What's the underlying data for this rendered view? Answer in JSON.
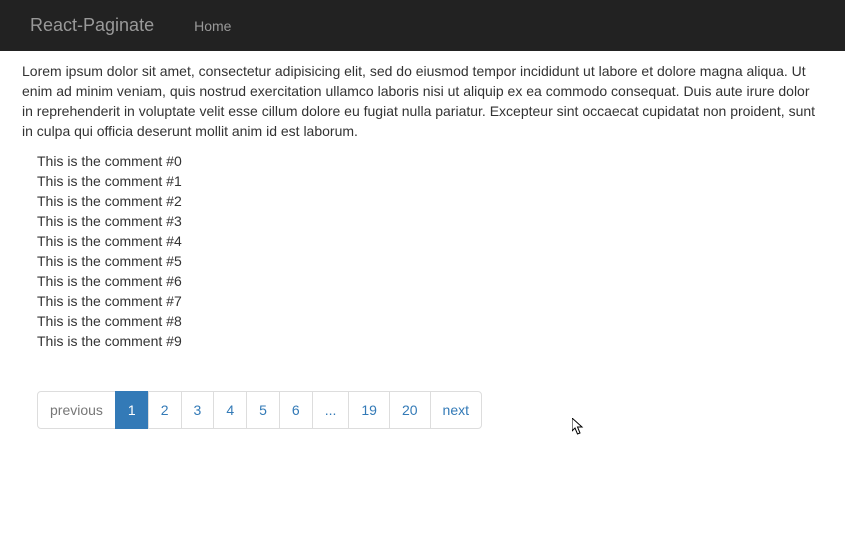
{
  "navbar": {
    "brand": "React-Paginate",
    "home_label": "Home"
  },
  "intro_text": "Lorem ipsum dolor sit amet, consectetur adipisicing elit, sed do eiusmod tempor incididunt ut labore et dolore magna aliqua. Ut enim ad minim veniam, quis nostrud exercitation ullamco laboris nisi ut aliquip ex ea commodo consequat. Duis aute irure dolor in reprehenderit in voluptate velit esse cillum dolore eu fugiat nulla pariatur. Excepteur sint occaecat cupidatat non proident, sunt in culpa qui officia deserunt mollit anim id est laborum.",
  "comments": [
    "This is the comment #0",
    "This is the comment #1",
    "This is the comment #2",
    "This is the comment #3",
    "This is the comment #4",
    "This is the comment #5",
    "This is the comment #6",
    "This is the comment #7",
    "This is the comment #8",
    "This is the comment #9"
  ],
  "pagination": {
    "previous_label": "previous",
    "next_label": "next",
    "break_label": "...",
    "pages_left": [
      "1",
      "2",
      "3",
      "4",
      "5",
      "6"
    ],
    "pages_right": [
      "19",
      "20"
    ],
    "active_page": "1",
    "previous_disabled": true
  }
}
